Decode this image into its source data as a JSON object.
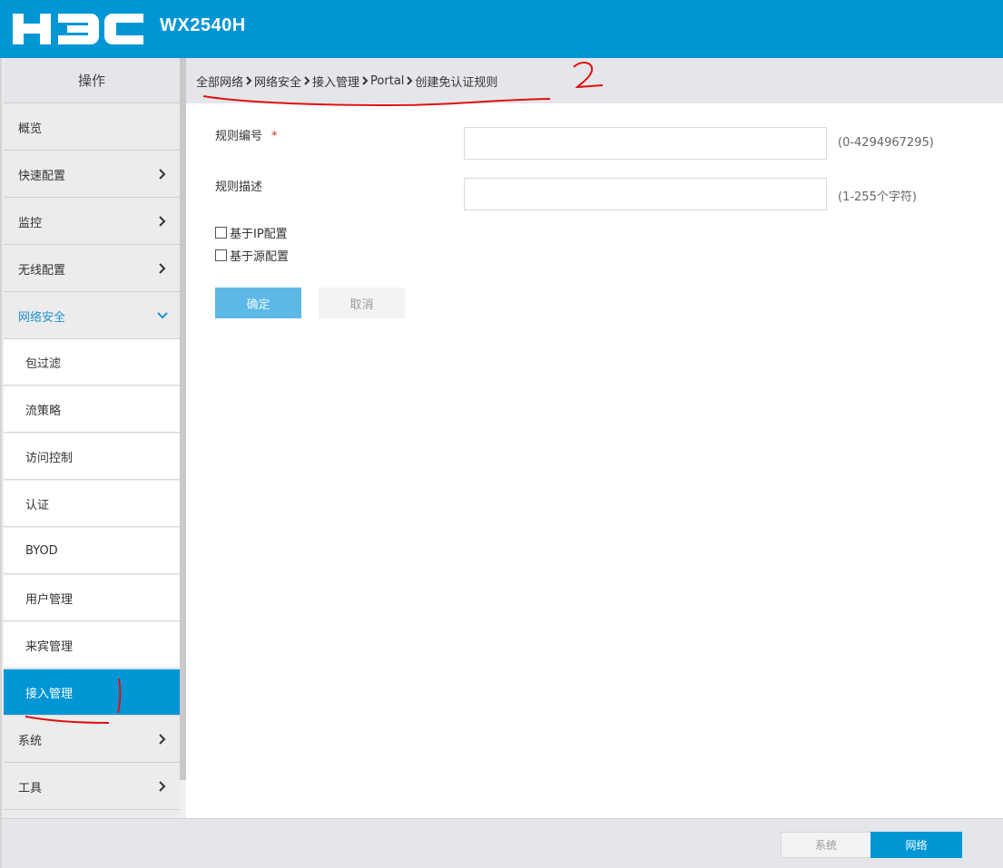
{
  "header": {
    "logo_text": "H3C",
    "model": "WX2540H",
    "brand_color": "#0096d6"
  },
  "sidebar": {
    "title": "操作",
    "items": [
      {
        "label": "概览",
        "arrow": "none"
      },
      {
        "label": "快速配置",
        "arrow": "right"
      },
      {
        "label": "监控",
        "arrow": "right"
      },
      {
        "label": "无线配置",
        "arrow": "right"
      },
      {
        "label": "网络安全",
        "arrow": "down",
        "expanded": true
      },
      {
        "label": "系统",
        "arrow": "right"
      },
      {
        "label": "工具",
        "arrow": "right"
      }
    ],
    "subitems": [
      {
        "label": "包过滤"
      },
      {
        "label": "流策略"
      },
      {
        "label": "访问控制"
      },
      {
        "label": "认证"
      },
      {
        "label": "BYOD"
      },
      {
        "label": "用户管理"
      },
      {
        "label": "来宾管理"
      },
      {
        "label": "接入管理",
        "active": true
      }
    ]
  },
  "breadcrumb": [
    "全部网络",
    "网络安全",
    "接入管理",
    "Portal",
    "创建免认证规则"
  ],
  "form": {
    "rule_id": {
      "label": "规则编号",
      "required_mark": "*",
      "value": "",
      "hint": "(0-4294967295)"
    },
    "rule_desc": {
      "label": "规则描述",
      "value": "",
      "hint": "(1-255个字符)"
    },
    "checkboxes": [
      {
        "label": "基于IP配置",
        "checked": false
      },
      {
        "label": "基于源配置",
        "checked": false
      }
    ],
    "ok_label": "确定",
    "cancel_label": "取消"
  },
  "footer": {
    "mode_system": "系统",
    "mode_network": "网络",
    "active_mode": "网络"
  },
  "annotations": {
    "mark_1": "1",
    "mark_2": "2",
    "color": "#e01010"
  }
}
